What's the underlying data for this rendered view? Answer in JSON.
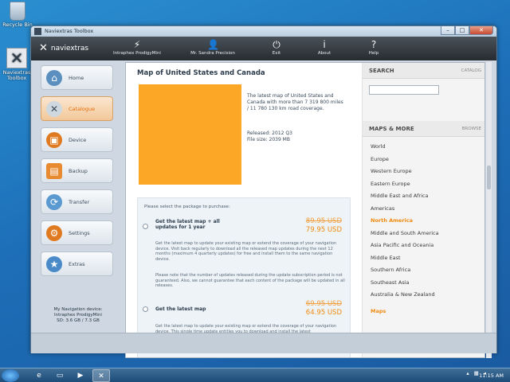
{
  "desktop": {
    "icons": [
      {
        "label": "Recycle Bin",
        "icon": "recycle-bin-icon"
      },
      {
        "label": "Naviextras Toolbox",
        "icon": "naviextras-app-icon"
      }
    ]
  },
  "window": {
    "title": "Naviextras Toolbox",
    "controls": {
      "minimize": "–",
      "maximize": "□",
      "close": "✕"
    }
  },
  "header": {
    "logo_text": "naviextras",
    "tools": [
      {
        "label": "Intraphex ProdigyMini",
        "icon": "device-plug-icon"
      },
      {
        "label": "Mr. Sandra Precision",
        "icon": "user-icon"
      },
      {
        "label": "Exit",
        "icon": "power-icon"
      },
      {
        "label": "About",
        "icon": "info-icon"
      },
      {
        "label": "Help",
        "icon": "help-icon"
      }
    ]
  },
  "sidebar": {
    "items": [
      {
        "label": "Home",
        "icon": "home-icon",
        "active": false
      },
      {
        "label": "Catalogue",
        "icon": "catalogue-icon",
        "active": true
      },
      {
        "label": "Device",
        "icon": "device-icon",
        "active": false
      },
      {
        "label": "Backup",
        "icon": "backup-icon",
        "active": false
      },
      {
        "label": "Transfer",
        "icon": "transfer-icon",
        "active": false
      },
      {
        "label": "Settings",
        "icon": "gear-icon",
        "active": false
      },
      {
        "label": "Extras",
        "icon": "star-icon",
        "active": false
      }
    ],
    "device_info": {
      "line1": "My Navigation device:",
      "line2": "Intraphex ProdigyMini",
      "line3": "SD: 3.6 GB / 7.3 GB"
    }
  },
  "product": {
    "title": "Map of United States and Canada",
    "description": "The latest map of United States and Canada with more than   7 319 800 miles / 11 780 130 km road coverage.",
    "released": "Released: 2012 Q3",
    "filesize": "File size: 2039 MB",
    "image_color": "#fca826",
    "select_prompt": "Please select the package to purchase:",
    "options": [
      {
        "name": "Get the latest map + all updates for 1 year",
        "old_price": "89.95 USD",
        "price": "79.95 USD",
        "desc1": "Get the latest map to update your existing map or extend the coverage of your navigation device. Visit back regularly to download all the released map updates during the next 12 months (maximum 4 quarterly updates) for free and install them to the same navigation device.",
        "desc2": "Please note that the number of updates released during the update subscription period is not guaranteed. Also, we cannot guarantee that each content of the package will be updated in all releases."
      },
      {
        "name": "Get the latest map",
        "old_price": "69.95 USD",
        "price": "64.95 USD",
        "desc1": "Get the latest map to update your existing map or extend the coverage of your navigation device. This single time update entitles you to download and install the latest"
      }
    ]
  },
  "search": {
    "heading": "SEARCH",
    "link": "CATALOG",
    "placeholder": ""
  },
  "maps_more": {
    "heading": "MAPS & MORE",
    "link": "BROWSE",
    "regions": [
      {
        "label": "World",
        "selected": false
      },
      {
        "label": "Europe",
        "selected": false
      },
      {
        "label": "Western Europe",
        "selected": false
      },
      {
        "label": "Eastern Europe",
        "selected": false
      },
      {
        "label": "Middle East and Africa",
        "selected": false
      },
      {
        "label": "Americas",
        "selected": false
      },
      {
        "label": "North America",
        "selected": true
      },
      {
        "label": "Middle and South America",
        "selected": false
      },
      {
        "label": "Asia Pacific and Oceania",
        "selected": false
      },
      {
        "label": "Middle East",
        "selected": false
      },
      {
        "label": "Southern Africa",
        "selected": false
      },
      {
        "label": "Southeast Asia",
        "selected": false
      },
      {
        "label": "Australia & New Zealand",
        "selected": false
      }
    ],
    "sort_label": "Maps"
  },
  "taskbar": {
    "clock": "11:15 AM",
    "apps": [
      {
        "icon": "internet-explorer-icon"
      },
      {
        "icon": "folder-icon"
      },
      {
        "icon": "media-player-icon"
      },
      {
        "icon": "naviextras-app-icon",
        "active": true
      }
    ]
  },
  "colors": {
    "accent": "#f08a10",
    "header_bg": "#2e3338",
    "desktop": "#1d6fb8"
  }
}
